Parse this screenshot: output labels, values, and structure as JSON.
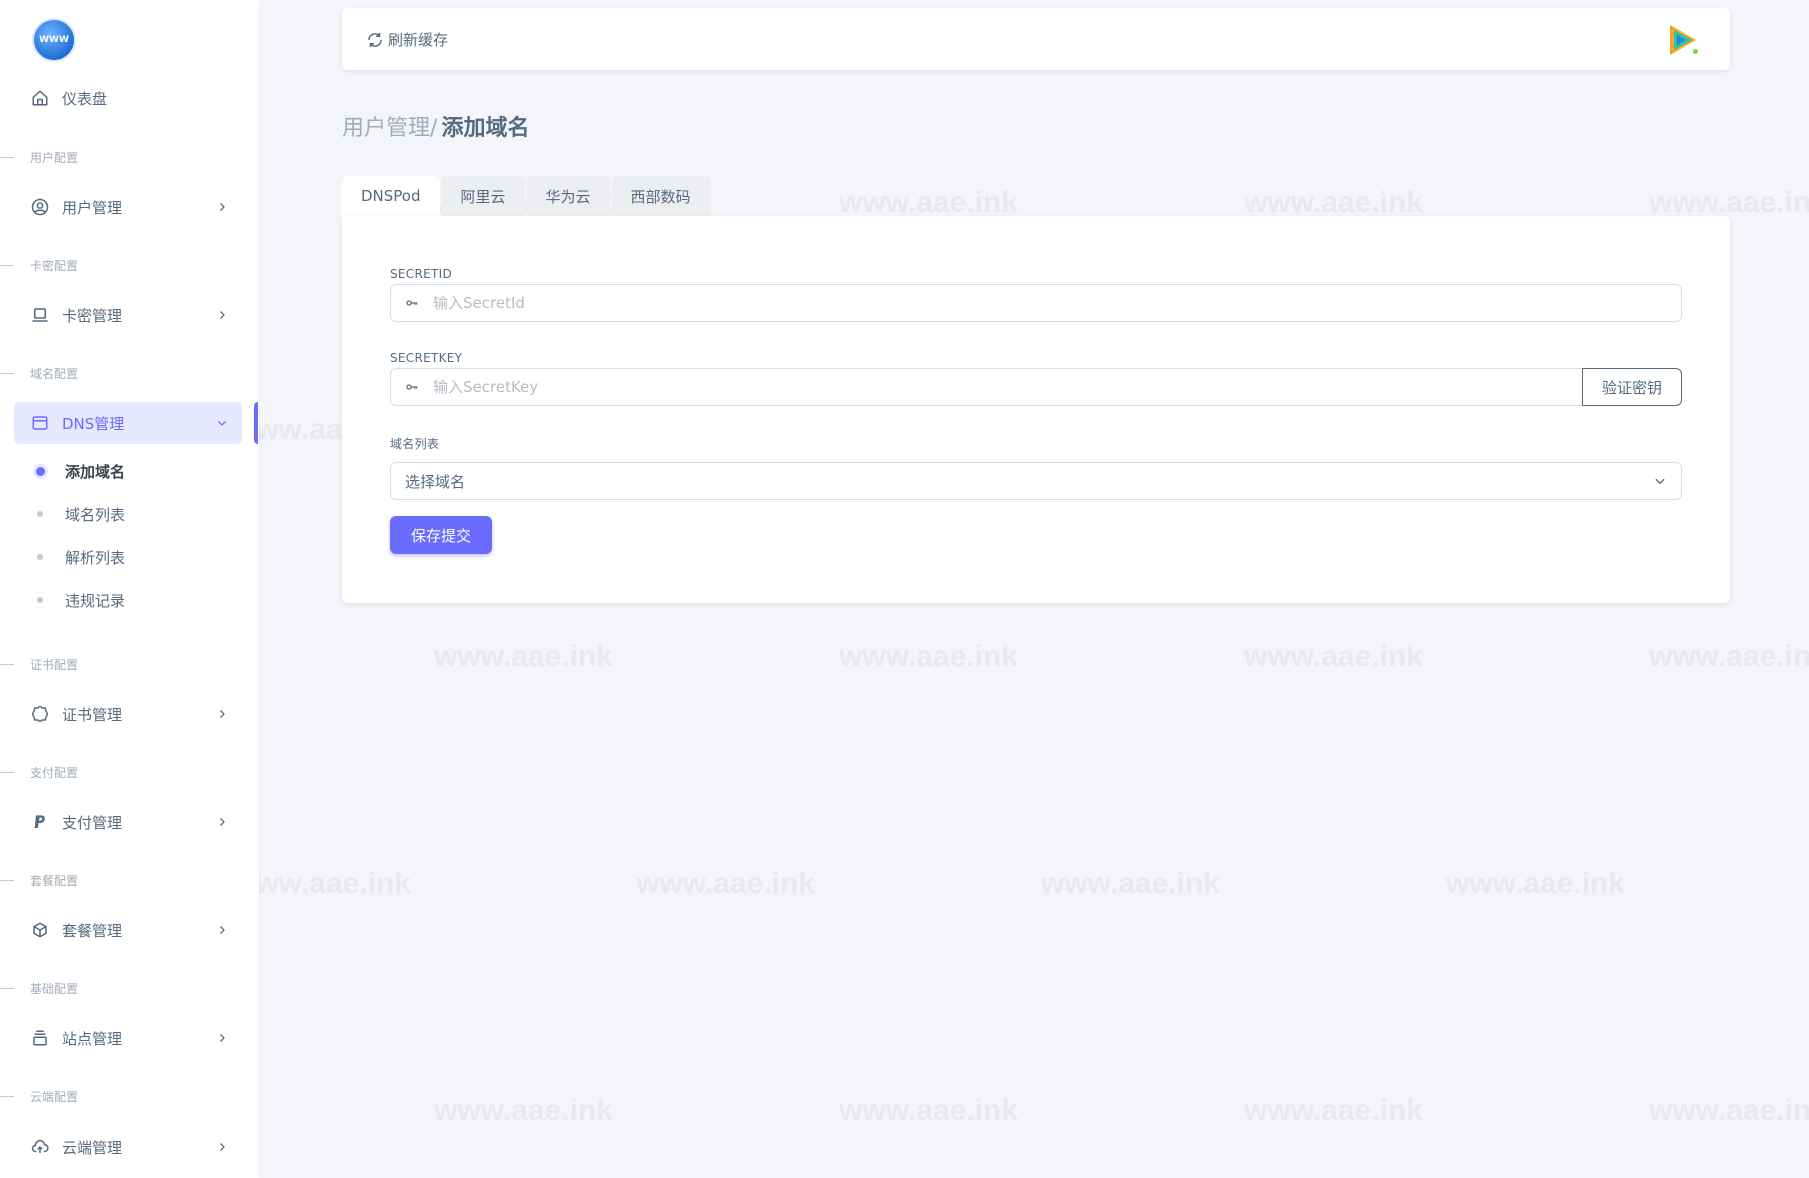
{
  "sidebar": {
    "logo_text": "WWW",
    "dashboard": "仪表盘",
    "sections": {
      "user": "用户配置",
      "card": "卡密配置",
      "domain": "域名配置",
      "cert": "证书配置",
      "pay": "支付配置",
      "plan": "套餐配置",
      "base": "基础配置",
      "cloud": "云端配置"
    },
    "items": {
      "user_mgmt": "用户管理",
      "card_mgmt": "卡密管理",
      "dns_mgmt": "DNS管理",
      "cert_mgmt": "证书管理",
      "pay_mgmt": "支付管理",
      "plan_mgmt": "套餐管理",
      "site_mgmt": "站点管理",
      "cloud_mgmt": "云端管理"
    },
    "dns_sub": {
      "add_domain": "添加域名",
      "domain_list": "域名列表",
      "record_list": "解析列表",
      "violations": "违规记录"
    }
  },
  "navbar": {
    "refresh_label": "刷新缓存"
  },
  "breadcrumb": {
    "parent": "用户管理",
    "separator": "/",
    "current": "添加域名"
  },
  "tabs": [
    "DNSPod",
    "阿里云",
    "华为云",
    "西部数码"
  ],
  "form": {
    "secret_id_label": "SECRETID",
    "secret_id_placeholder": "输入SecretId",
    "secret_key_label": "SECRETKEY",
    "secret_key_placeholder": "输入SecretKey",
    "verify_label": "验证密钥",
    "domain_list_label": "域名列表",
    "domain_select_value": "选择域名",
    "submit_label": "保存提交"
  },
  "watermark_text": "www.aae.ink",
  "colors": {
    "primary": "#696cff",
    "primary_light": "#e7e7ff",
    "text": "#566a7f",
    "muted": "#a1acb8",
    "background": "#f4f5fa",
    "online": "#71dd37"
  }
}
